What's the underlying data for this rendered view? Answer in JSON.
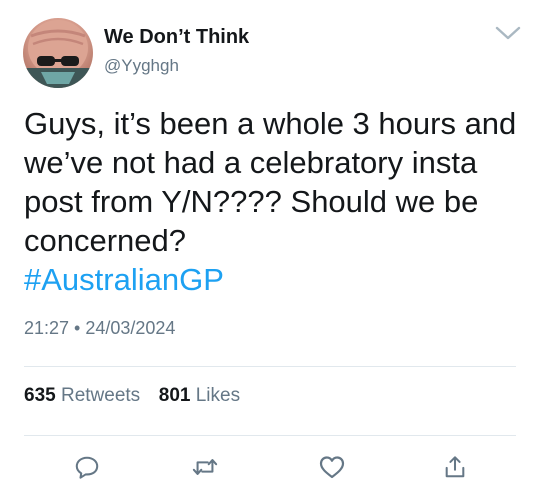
{
  "user": {
    "display_name": "We Don’t Think",
    "handle": "@Yyghgh"
  },
  "tweet": {
    "text": "Guys, it’s been a whole 3 hours and we’ve not had a celebratory insta post from Y/N???? Should we be concerned?",
    "hashtag": "#AustralianGP",
    "timestamp": "21:27 • 24/03/2024"
  },
  "stats": {
    "retweets_count": "635",
    "retweets_label": "Retweets",
    "likes_count": "801",
    "likes_label": "Likes"
  },
  "icons": {
    "menu": "chevron-down-icon",
    "reply": "reply-icon",
    "retweet": "retweet-icon",
    "like": "heart-icon",
    "share": "share-icon"
  },
  "colors": {
    "hashtag": "#1da1f2",
    "secondary_text": "#657786",
    "icon": "#657786",
    "divider": "#e1e8ed"
  }
}
